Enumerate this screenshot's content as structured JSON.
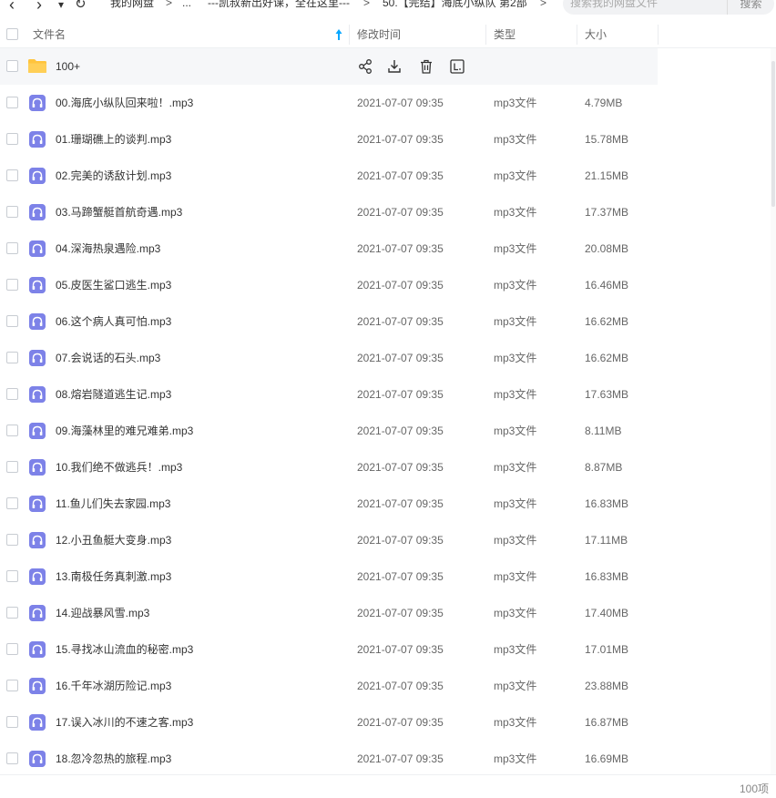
{
  "nav": {
    "back_glyph": "‹",
    "forward_glyph": "›",
    "dropdown_glyph": "▾",
    "refresh_glyph": "↻",
    "breadcrumbs": [
      "我的网盘",
      "...",
      "---凯叔新出好课，全在这里---",
      "50.【完结】海底小纵队 第2部"
    ],
    "separator": ">"
  },
  "search": {
    "placeholder": "搜索我的网盘文件",
    "button_label": "搜索"
  },
  "columns": {
    "name": "文件名",
    "modified": "修改时间",
    "type": "类型",
    "size": "大小"
  },
  "folder": {
    "name": "100+",
    "actions": [
      "share-icon",
      "download-icon",
      "delete-icon",
      "more-icon"
    ]
  },
  "files": [
    {
      "name": "00.海底小纵队回来啦！.mp3",
      "modified": "2021-07-07 09:35",
      "type": "mp3文件",
      "size": "4.79MB"
    },
    {
      "name": "01.珊瑚礁上的谈判.mp3",
      "modified": "2021-07-07 09:35",
      "type": "mp3文件",
      "size": "15.78MB"
    },
    {
      "name": "02.完美的诱敌计划.mp3",
      "modified": "2021-07-07 09:35",
      "type": "mp3文件",
      "size": "21.15MB"
    },
    {
      "name": "03.马蹄蟹艇首航奇遇.mp3",
      "modified": "2021-07-07 09:35",
      "type": "mp3文件",
      "size": "17.37MB"
    },
    {
      "name": "04.深海热泉遇险.mp3",
      "modified": "2021-07-07 09:35",
      "type": "mp3文件",
      "size": "20.08MB"
    },
    {
      "name": "05.皮医生鲨口逃生.mp3",
      "modified": "2021-07-07 09:35",
      "type": "mp3文件",
      "size": "16.46MB"
    },
    {
      "name": "06.这个病人真可怕.mp3",
      "modified": "2021-07-07 09:35",
      "type": "mp3文件",
      "size": "16.62MB"
    },
    {
      "name": "07.会说话的石头.mp3",
      "modified": "2021-07-07 09:35",
      "type": "mp3文件",
      "size": "16.62MB"
    },
    {
      "name": "08.熔岩隧道逃生记.mp3",
      "modified": "2021-07-07 09:35",
      "type": "mp3文件",
      "size": "17.63MB"
    },
    {
      "name": "09.海藻林里的难兄难弟.mp3",
      "modified": "2021-07-07 09:35",
      "type": "mp3文件",
      "size": "8.11MB"
    },
    {
      "name": "10.我们绝不做逃兵！.mp3",
      "modified": "2021-07-07 09:35",
      "type": "mp3文件",
      "size": "8.87MB"
    },
    {
      "name": "11.鱼儿们失去家园.mp3",
      "modified": "2021-07-07 09:35",
      "type": "mp3文件",
      "size": "16.83MB"
    },
    {
      "name": "12.小丑鱼艇大变身.mp3",
      "modified": "2021-07-07 09:35",
      "type": "mp3文件",
      "size": "17.11MB"
    },
    {
      "name": "13.南极任务真刺激.mp3",
      "modified": "2021-07-07 09:35",
      "type": "mp3文件",
      "size": "16.83MB"
    },
    {
      "name": "14.迎战暴风雪.mp3",
      "modified": "2021-07-07 09:35",
      "type": "mp3文件",
      "size": "17.40MB"
    },
    {
      "name": "15.寻找冰山流血的秘密.mp3",
      "modified": "2021-07-07 09:35",
      "type": "mp3文件",
      "size": "17.01MB"
    },
    {
      "name": "16.千年冰湖历险记.mp3",
      "modified": "2021-07-07 09:35",
      "type": "mp3文件",
      "size": "23.88MB"
    },
    {
      "name": "17.误入冰川的不速之客.mp3",
      "modified": "2021-07-07 09:35",
      "type": "mp3文件",
      "size": "16.87MB"
    },
    {
      "name": "18.忽冷忽热的旅程.mp3",
      "modified": "2021-07-07 09:35",
      "type": "mp3文件",
      "size": "16.69MB"
    }
  ],
  "footer": {
    "count": "100项"
  },
  "colors": {
    "accent": "#06a7ff",
    "music_icon": "#7d82e8",
    "folder": "#ffc43d"
  }
}
